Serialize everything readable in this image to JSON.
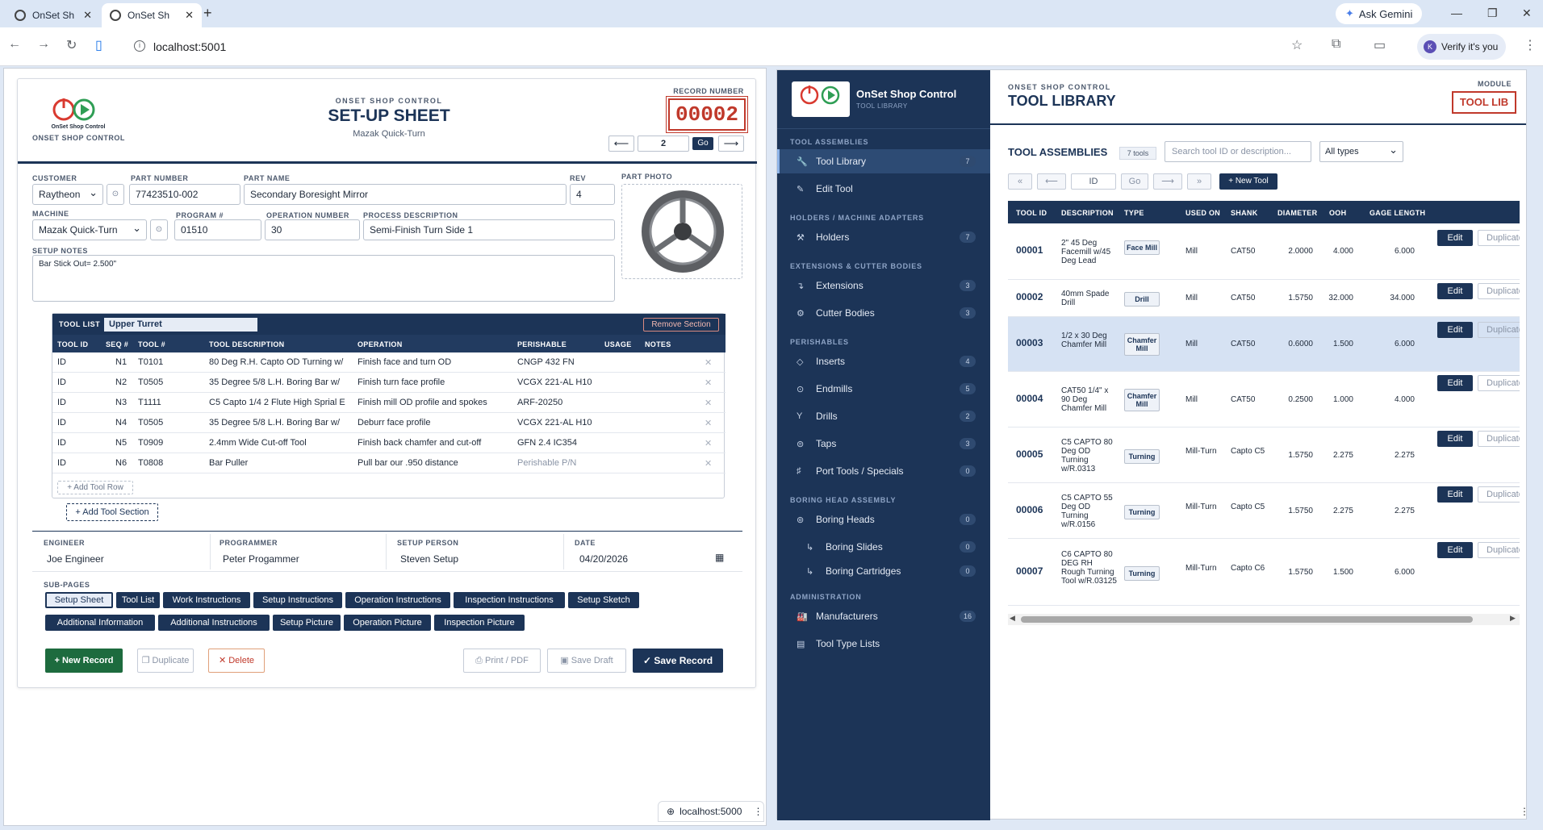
{
  "browser": {
    "tabs": [
      {
        "title": "OnSet Sh"
      },
      {
        "title": "OnSet Sh"
      }
    ],
    "url": "localhost:5001",
    "gemini": "Ask Gemini",
    "verify": "Verify it's you",
    "avatar_letter": "K",
    "status_url": "localhost:5000"
  },
  "setup": {
    "brand": "ONSET SHOP CONTROL",
    "logo_text": "OnSet Shop Control",
    "header_kicker": "ONSET SHOP CONTROL",
    "title": "SET-UP SHEET",
    "subtitle": "Mazak Quick-Turn",
    "record_label": "RECORD NUMBER",
    "record_number": "00002",
    "nav_value": "2",
    "go": "Go",
    "prev_arrow": "⟵",
    "next_arrow": "⟶",
    "labels": {
      "customer": "CUSTOMER",
      "part_number": "PART NUMBER",
      "part_name": "PART NAME",
      "rev": "REV",
      "machine": "MACHINE",
      "program": "PROGRAM #",
      "operation_number": "OPERATION NUMBER",
      "process_description": "PROCESS DESCRIPTION",
      "setup_notes": "SETUP NOTES",
      "part_photo": "PART PHOTO",
      "engineer": "ENGINEER",
      "programmer": "PROGRAMMER",
      "setup_person": "SETUP PERSON",
      "date": "DATE",
      "subpages": "SUB-PAGES"
    },
    "values": {
      "customer": "Raytheon",
      "part_number": "77423510-002",
      "part_name": "Secondary Boresight Mirror",
      "rev": "4",
      "machine": "Mazak Quick-Turn",
      "program": "01510",
      "operation_number": "30",
      "process_description": "Semi-Finish Turn Side 1",
      "setup_notes": "Bar Stick Out= 2.500\"",
      "engineer": "Joe Engineer",
      "programmer": "Peter Progammer",
      "setup_person": "Steven Setup",
      "date": "04/20/2026"
    },
    "tool_list": {
      "label": "TOOL LIST",
      "section_name": "Upper Turret",
      "remove_section": "Remove Section",
      "columns": [
        "TOOL ID",
        "SEQ #",
        "TOOL #",
        "TOOL DESCRIPTION",
        "OPERATION",
        "PERISHABLE",
        "USAGE",
        "NOTES"
      ],
      "rows": [
        {
          "id": "ID",
          "seq": "N1",
          "tool": "T0101",
          "desc": "80 Deg R.H. Capto OD Turning w/",
          "op": "Finish face and turn OD",
          "perish": "CNGP 432 FN"
        },
        {
          "id": "ID",
          "seq": "N2",
          "tool": "T0505",
          "desc": "35 Degree 5/8 L.H. Boring Bar w/",
          "op": "Finish turn face profile",
          "perish": "VCGX 221-AL H10"
        },
        {
          "id": "ID",
          "seq": "N3",
          "tool": "T1111",
          "desc": "C5 Capto 1/4 2 Flute High Sprial E",
          "op": "Finish mill OD profile and spokes",
          "perish": "ARF-20250"
        },
        {
          "id": "ID",
          "seq": "N4",
          "tool": "T0505",
          "desc": "35 Degree 5/8 L.H. Boring Bar w/",
          "op": "Deburr face profile",
          "perish": "VCGX 221-AL H10"
        },
        {
          "id": "ID",
          "seq": "N5",
          "tool": "T0909",
          "desc": "2.4mm Wide Cut-off Tool",
          "op": "Finish back chamfer and cut-off",
          "perish": "GFN 2.4 IC354"
        },
        {
          "id": "ID",
          "seq": "N6",
          "tool": "T0808",
          "desc": "Bar Puller",
          "op": "Pull bar our .950 distance",
          "perish": "Perishable P/N"
        }
      ],
      "add_row": "+ Add Tool Row",
      "add_section": "+ Add Tool Section"
    },
    "subpages": [
      "Setup Sheet",
      "Tool List",
      "Work Instructions",
      "Setup Instructions",
      "Operation Instructions",
      "Inspection Instructions",
      "Setup Sketch",
      "Additional Information",
      "Additional Instructions",
      "Setup Picture",
      "Operation Picture",
      "Inspection Picture"
    ],
    "actions": {
      "new_record": "+ New Record",
      "duplicate": "❐ Duplicate",
      "delete": "✕ Delete",
      "print": "⎙ Print / PDF",
      "save_draft": "▣ Save Draft",
      "save_record": "✓ Save Record"
    }
  },
  "library": {
    "logo_title": "OnSet Shop Control",
    "logo_sub": "TOOL LIBRARY",
    "kicker": "ONSET SHOP CONTROL",
    "title": "TOOL LIBRARY",
    "module_label": "MODULE",
    "module_value": "TOOL LIB",
    "sidebar": [
      {
        "head": "TOOL ASSEMBLIES"
      },
      {
        "label": "Tool Library",
        "count": "7",
        "icon": "🔧",
        "active": true
      },
      {
        "label": "Edit Tool",
        "icon": "✎"
      },
      {
        "head": "HOLDERS / MACHINE ADAPTERS"
      },
      {
        "label": "Holders",
        "count": "7",
        "icon": "⚒"
      },
      {
        "head": "EXTENSIONS & CUTTER BODIES"
      },
      {
        "label": "Extensions",
        "count": "3",
        "icon": "↴"
      },
      {
        "label": "Cutter Bodies",
        "count": "3",
        "icon": "⚙"
      },
      {
        "head": "PERISHABLES"
      },
      {
        "label": "Inserts",
        "count": "4",
        "icon": "◇"
      },
      {
        "label": "Endmills",
        "count": "5",
        "icon": "⊙"
      },
      {
        "label": "Drills",
        "count": "2",
        "icon": "Y"
      },
      {
        "label": "Taps",
        "count": "3",
        "icon": "⊜"
      },
      {
        "label": "Port Tools / Specials",
        "count": "0",
        "icon": "♯"
      },
      {
        "head": "BORING HEAD ASSEMBLY"
      },
      {
        "label": "Boring Heads",
        "count": "0",
        "icon": "⊚"
      },
      {
        "label": "Boring Slides",
        "count": "0",
        "icon": "↳",
        "sub": true
      },
      {
        "label": "Boring Cartridges",
        "count": "0",
        "icon": "↳",
        "sub": true
      },
      {
        "head": "ADMINISTRATION"
      },
      {
        "label": "Manufacturers",
        "count": "16",
        "icon": "🏭"
      },
      {
        "label": "Tool Type Lists",
        "icon": "▤"
      }
    ],
    "assemblies_title": "TOOL ASSEMBLIES",
    "tools_count": "7 tools",
    "search_placeholder": "Search tool ID or description...",
    "type_filter": "All types",
    "pager": {
      "first": "«",
      "prev": "⟵",
      "id_placeholder": "ID",
      "go": "Go",
      "next": "⟶",
      "last": "»",
      "new_tool": "+ New Tool"
    },
    "columns": [
      "TOOL ID",
      "DESCRIPTION",
      "TYPE",
      "USED ON",
      "SHANK",
      "DIAMETER",
      "OOH",
      "GAGE LENGTH"
    ],
    "rows": [
      {
        "id": "00001",
        "desc": "2\" 45 Deg Facemill w/45 Deg Lead",
        "type": "Face Mill",
        "used": "Mill",
        "shank": "CAT50",
        "dia": "2.0000",
        "ooh": "4.000",
        "gage": "6.000"
      },
      {
        "id": "00002",
        "desc": "40mm Spade Drill",
        "type": "Drill",
        "used": "Mill",
        "shank": "CAT50",
        "dia": "1.5750",
        "ooh": "32.000",
        "gage": "34.000"
      },
      {
        "id": "00003",
        "desc": "1/2 x 30 Deg Chamfer Mill",
        "type": "Chamfer Mill",
        "used": "Mill",
        "shank": "CAT50",
        "dia": "0.6000",
        "ooh": "1.500",
        "gage": "6.000"
      },
      {
        "id": "00004",
        "desc": "CAT50 1/4\" x 90 Deg Chamfer Mill",
        "type": "Chamfer Mill",
        "used": "Mill",
        "shank": "CAT50",
        "dia": "0.2500",
        "ooh": "1.000",
        "gage": "4.000"
      },
      {
        "id": "00005",
        "desc": "C5 CAPTO 80 Deg OD Turning w/R.0313",
        "type": "Turning",
        "used": "Mill-Turn",
        "shank": "Capto C5",
        "dia": "1.5750",
        "ooh": "2.275",
        "gage": "2.275"
      },
      {
        "id": "00006",
        "desc": "C5 CAPTO 55 Deg OD Turning w/R.0156",
        "type": "Turning",
        "used": "Mill-Turn",
        "shank": "Capto C5",
        "dia": "1.5750",
        "ooh": "2.275",
        "gage": "2.275"
      },
      {
        "id": "00007",
        "desc": "C6 CAPTO 80 DEG RH Rough Turning Tool w/R.03125",
        "type": "Turning",
        "used": "Mill-Turn",
        "shank": "Capto C6",
        "dia": "1.5750",
        "ooh": "1.500",
        "gage": "6.000"
      }
    ],
    "edit": "Edit",
    "duplicate": "Duplicate"
  }
}
